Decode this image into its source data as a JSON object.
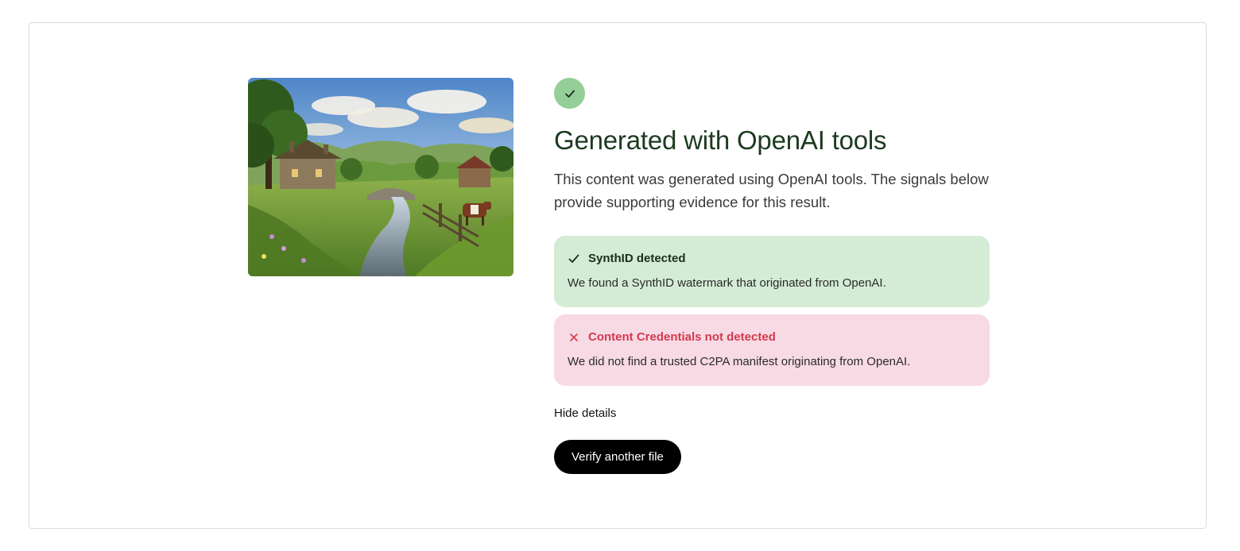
{
  "result": {
    "title": "Generated with OpenAI tools",
    "description": "This content was generated using OpenAI tools. The signals below provide supporting evidence for this result.",
    "status_icon": "check-icon",
    "status_color": "#94cf98"
  },
  "image": {
    "alt": "Countryside landscape with a cottage, stream, stone bridge and a cow"
  },
  "signals": [
    {
      "status": "detected",
      "icon": "check-icon",
      "heading": "SynthID detected",
      "body": "We found a SynthID watermark that originated from OpenAI.",
      "background": "#d4ecd5"
    },
    {
      "status": "not-detected",
      "icon": "close-icon",
      "heading": "Content Credentials not detected",
      "body": "We did not find a trusted C2PA manifest originating from OpenAI.",
      "background": "#f8dae5",
      "accent": "#d23a4c"
    }
  ],
  "actions": {
    "hide_details": "Hide details",
    "verify_another": "Verify another file"
  }
}
